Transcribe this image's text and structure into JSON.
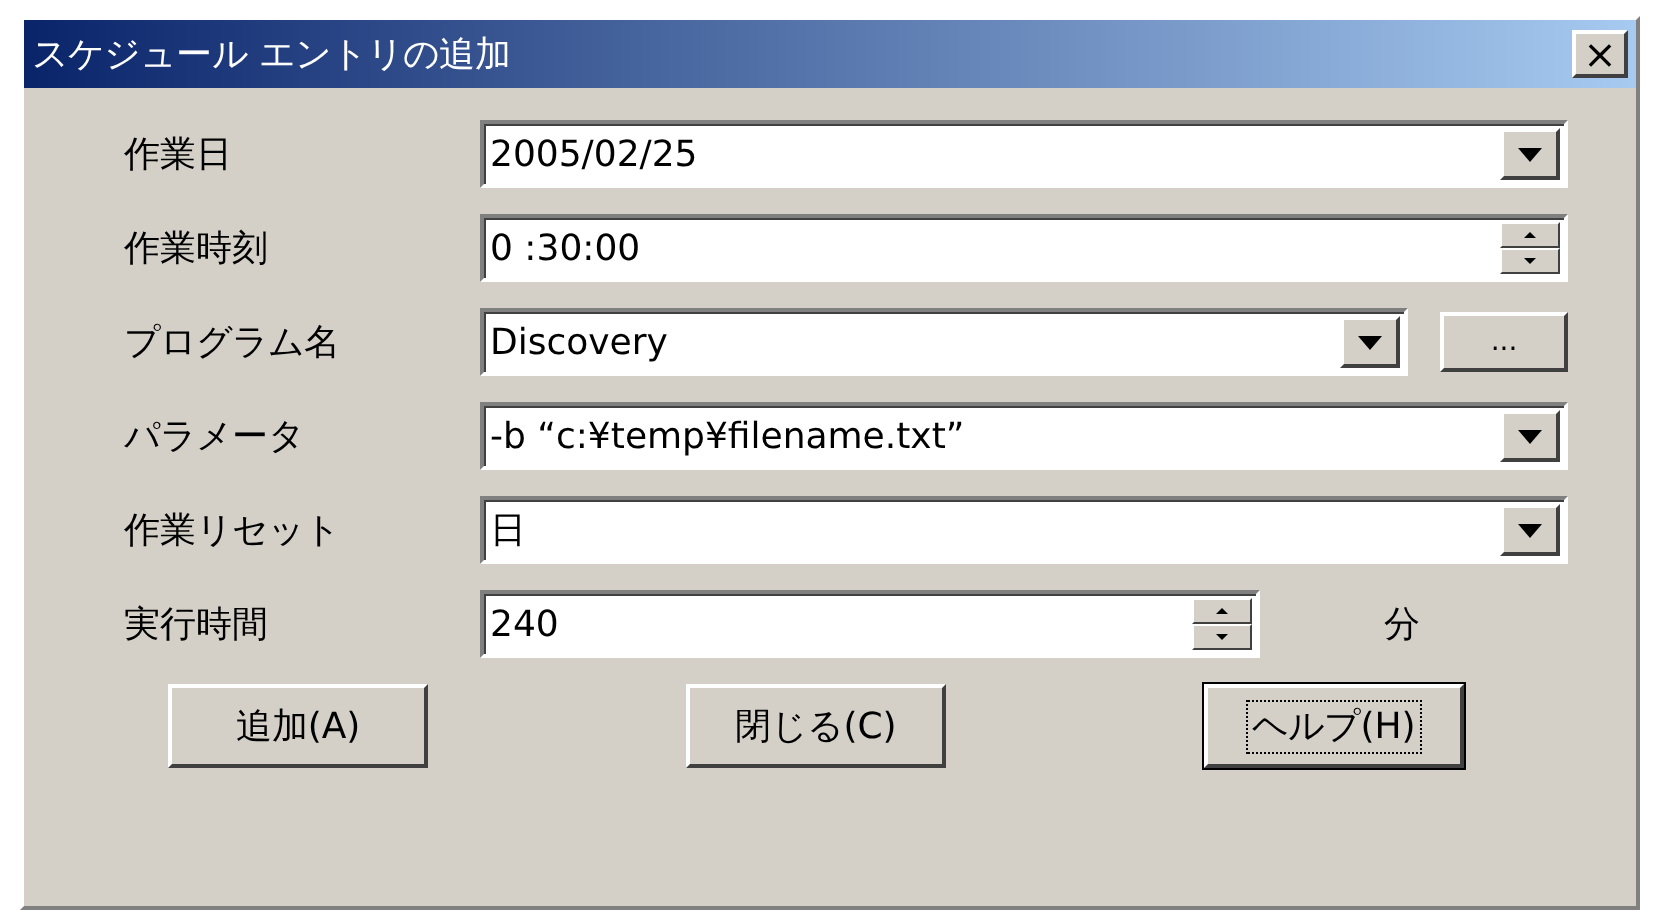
{
  "window": {
    "title": "スケジュール エントリの追加",
    "close": "×"
  },
  "rows": [
    {
      "label": "作業日",
      "kind": "combo",
      "value": "2005/02/25"
    },
    {
      "label": "作業時刻",
      "kind": "spin",
      "value": "0 :30:00"
    },
    {
      "label": "プログラム名",
      "kind": "combo_browse",
      "value": "Discovery",
      "browse": "..."
    },
    {
      "label": "パラメータ",
      "kind": "combo",
      "value": "-b “c:¥temp¥filename.txt”"
    },
    {
      "label": "作業リセット",
      "kind": "combo",
      "value": "日"
    },
    {
      "label": "実行時間",
      "kind": "spin_unit",
      "value": "240",
      "unit": "分"
    }
  ],
  "buttons": [
    {
      "label": "追加(A)",
      "focused": false
    },
    {
      "label": "閉じる(C)",
      "focused": false
    },
    {
      "label": "ヘルプ(H)",
      "focused": true
    }
  ]
}
